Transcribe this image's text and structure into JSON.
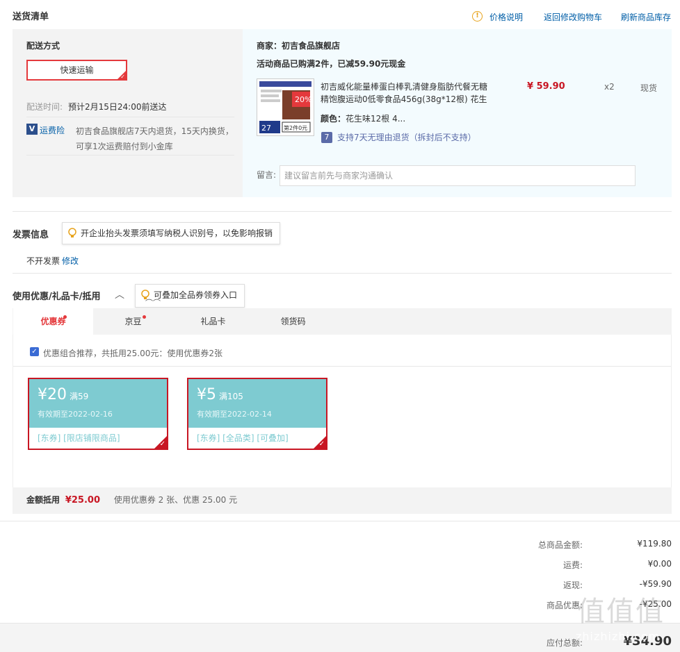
{
  "header": {
    "title": "送货清单",
    "price_note": "价格说明",
    "back_to_cart": "返回修改购物车",
    "refresh_stock": "刷新商品库存"
  },
  "delivery": {
    "method_label": "配送方式",
    "method_value": "快速运输",
    "time_label": "配送时间:",
    "time_value": "预计2月15日24:00前送达",
    "insurance_label": "运费险",
    "insurance_text_1": "初吉食品旗舰店7天内退货，15天内换货，",
    "insurance_text_2": "可享1次运费赔付到小金库"
  },
  "order": {
    "merchant": "商家：初吉食品旗舰店",
    "promo": "活动商品已购满2件，已减59.90元现金",
    "product_name_1": "初吉威化能量棒蛋白棒乳清健身脂肪代餐无糖",
    "product_name_2": "精饱腹运动0低零食品456g(38g*12根) 花生",
    "price": "¥ 59.90",
    "qty": "x2",
    "stock": "现货",
    "color_label": "颜色：",
    "color_value": "花生味12根 4...",
    "return_policy": "支持7天无理由退货（拆封后不支持）",
    "img_badge": "第2件0元",
    "img_num": "27",
    "img_pct": "20%",
    "remark_label": "留言:",
    "remark_placeholder": "建议留言前先与商家沟通确认"
  },
  "invoice": {
    "title": "发票信息",
    "tip": "开企业抬头发票须填写纳税人识别号，以免影响报销",
    "value": "不开发票",
    "edit": "修改"
  },
  "discount": {
    "title": "使用优惠/礼品卡/抵用",
    "tip": "可叠加全品券领券入口",
    "tabs": [
      "优惠券",
      "京豆",
      "礼品卡",
      "领货码"
    ],
    "combo_text": "优惠组合推荐，共抵用25.00元：使用优惠券2张",
    "coupons": [
      {
        "amount": "¥20",
        "condition": "满59",
        "expiry": "有效期至2022-02-16",
        "tags": "[东券]  [限店铺限商品]"
      },
      {
        "amount": "¥5",
        "condition": "满105",
        "expiry": "有效期至2022-02-14",
        "tags": "[东券]  [全品类]  [可叠加]"
      }
    ],
    "sum_label": "金额抵用",
    "sum_value": "¥25.00",
    "sum_desc": "使用优惠券 2 张、优惠 25.00 元"
  },
  "totals": {
    "goods_label": "总商品金额:",
    "goods_value": "¥119.80",
    "shipping_label": "运费:",
    "shipping_value": "¥0.00",
    "rebate_label": "返现:",
    "rebate_value": "-¥59.90",
    "discount_label": "商品优惠:",
    "discount_value": "-¥25.00",
    "payable_label": "应付总额:",
    "payable_value": "¥34.90"
  },
  "watermark": {
    "logo": "值值值",
    "site": "zhizhizhi.com"
  },
  "colors": {
    "accent_red": "#e4393c",
    "coupon_teal": "#7ecbd1",
    "link_blue": "#005ea7"
  }
}
